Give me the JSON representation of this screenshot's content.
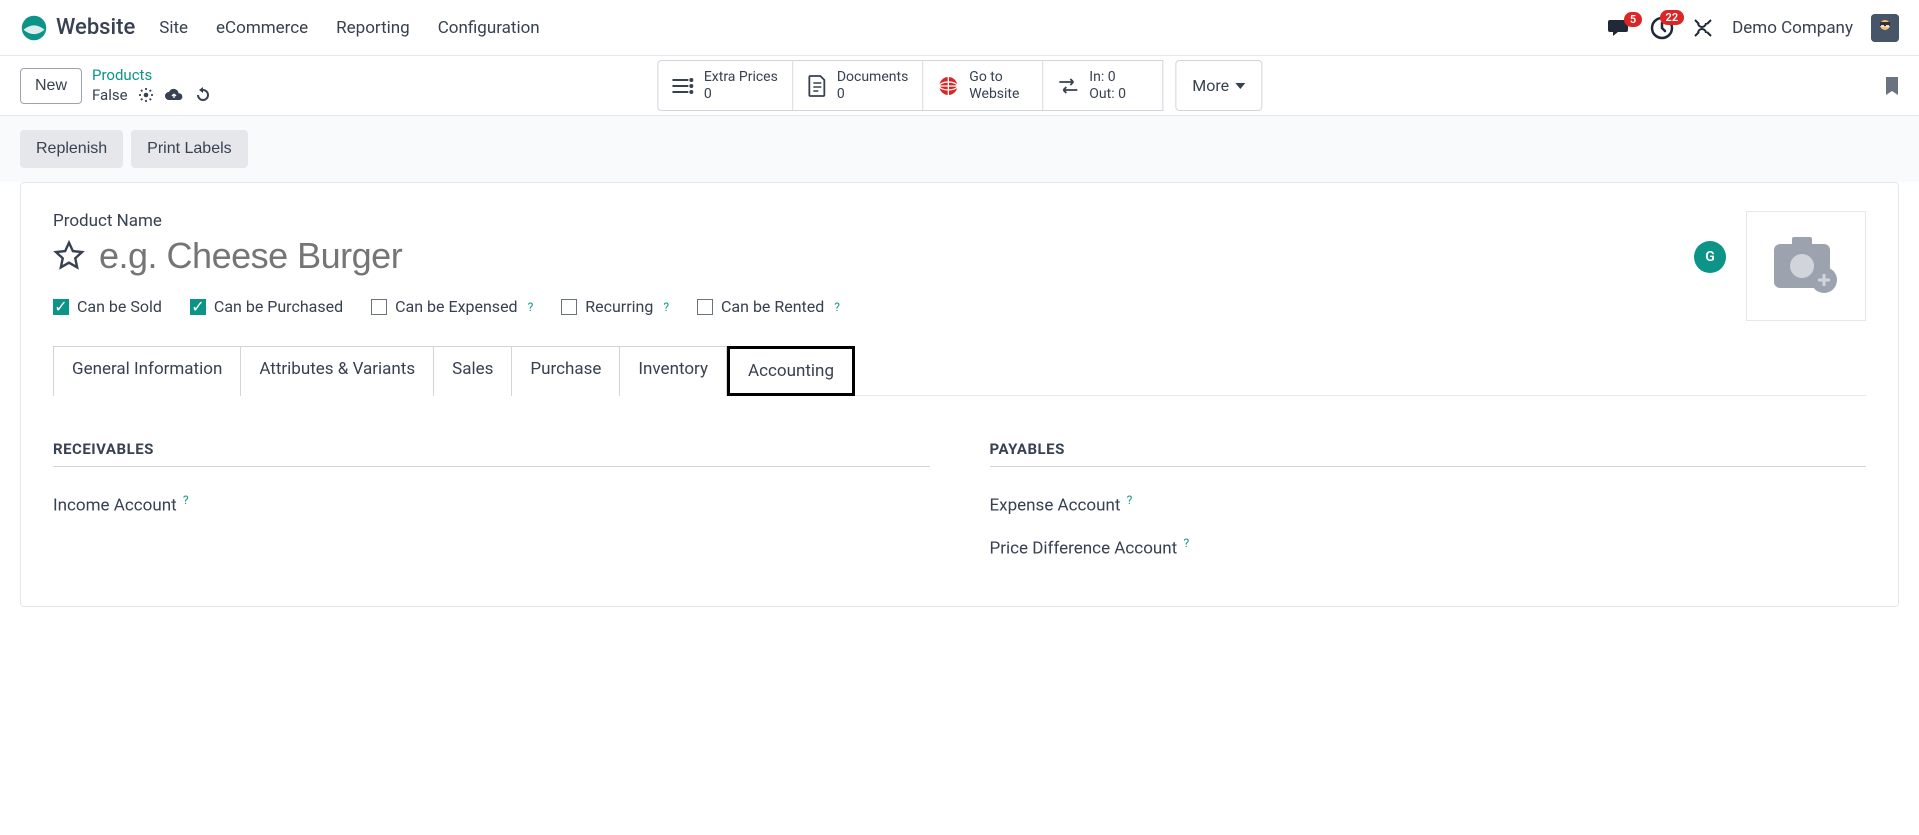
{
  "topnav": {
    "app_name": "Website",
    "links": [
      "Site",
      "eCommerce",
      "Reporting",
      "Configuration"
    ],
    "messages_badge": "5",
    "activities_badge": "22",
    "company": "Demo Company"
  },
  "controlbar": {
    "new_label": "New",
    "breadcrumb_parent": "Products",
    "breadcrumb_current": "False",
    "stats": {
      "extra_prices_label": "Extra Prices",
      "extra_prices_count": "0",
      "documents_label": "Documents",
      "documents_count": "0",
      "go_to_website_line1": "Go to",
      "go_to_website_line2": "Website",
      "inout_in": "In: 0",
      "inout_out": "Out: 0"
    },
    "more_label": "More"
  },
  "actions": {
    "replenish": "Replenish",
    "print_labels": "Print Labels"
  },
  "form": {
    "product_name_label": "Product Name",
    "product_name_placeholder": "e.g. Cheese Burger",
    "checkboxes": {
      "sold": "Can be Sold",
      "purchased": "Can be Purchased",
      "expensed": "Can be Expensed",
      "recurring": "Recurring",
      "rented": "Can be Rented"
    },
    "tabs": {
      "general": "General Information",
      "attrs": "Attributes & Variants",
      "sales": "Sales",
      "purchase": "Purchase",
      "inventory": "Inventory",
      "accounting": "Accounting"
    },
    "accounting": {
      "receivables_h": "RECEIVABLES",
      "income_account": "Income Account",
      "payables_h": "PAYABLES",
      "expense_account": "Expense Account",
      "price_diff_account": "Price Difference Account"
    }
  }
}
